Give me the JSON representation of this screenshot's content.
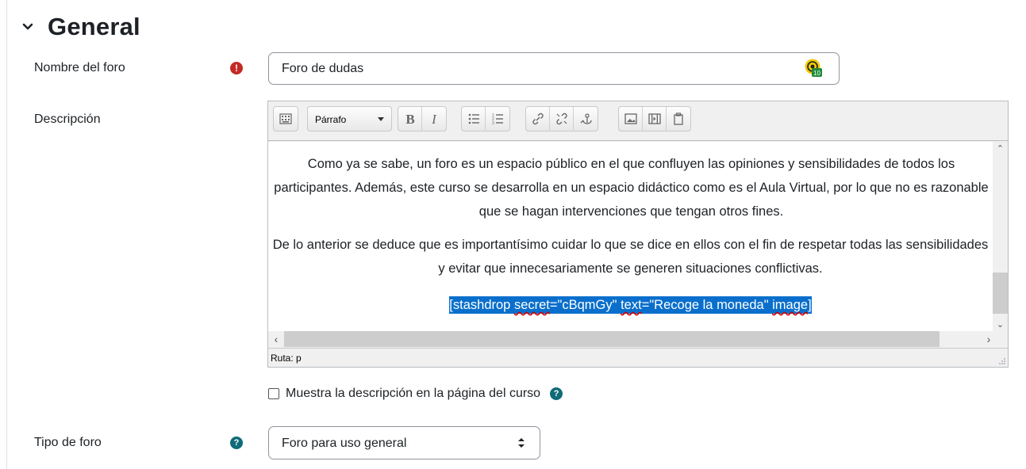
{
  "section": {
    "title": "General",
    "icon": "chevron-down-icon"
  },
  "fields": {
    "name": {
      "label": "Nombre del foro",
      "value": "Foro de dudas",
      "required_icon": "exclamation-icon",
      "badge_number": "10"
    },
    "description": {
      "label": "Descripción",
      "toolbar": {
        "format_select": "Párrafo",
        "buttons": [
          "toggle-toolbar-icon",
          "bold-icon",
          "italic-icon",
          "unordered-list-icon",
          "ordered-list-icon",
          "link-icon",
          "unlink-icon",
          "anchor-icon",
          "image-icon",
          "media-icon",
          "paste-icon"
        ]
      },
      "paragraph1": "Como ya se sabe, un foro es un espacio público en el que confluyen las opiniones y sensibilidades de todos los participantes. Además, este curso se desarrolla en un espacio didáctico como es el Aula Virtual, por lo que no es razonable que se hagan intervenciones que tengan otros fines.",
      "paragraph2": "De lo anterior se deduce que es importantísimo cuidar lo que se dice en ellos con el fin de respetar todas las sensibilidades y evitar que innecesariamente se generen situaciones conflictivas.",
      "shortcode": {
        "open": "[stashdrop ",
        "secret_word": "secret",
        "secret_val": "=\"cBqmGy\" ",
        "text_word": "text",
        "text_val": "=\"Recoge la moneda\" ",
        "image_word": "image",
        "close": "]"
      },
      "path": "Ruta: p",
      "show_on_course_label": "Muestra la descripción en la página del curso",
      "show_on_course_checked": false
    },
    "type": {
      "label": "Tipo de foro",
      "value": "Foro para uso general",
      "help_icon": "question-icon"
    }
  },
  "colors": {
    "required": "#c42a25",
    "help": "#0f6b78",
    "selection": "#0a6fcc",
    "badge": "#f0c800"
  }
}
